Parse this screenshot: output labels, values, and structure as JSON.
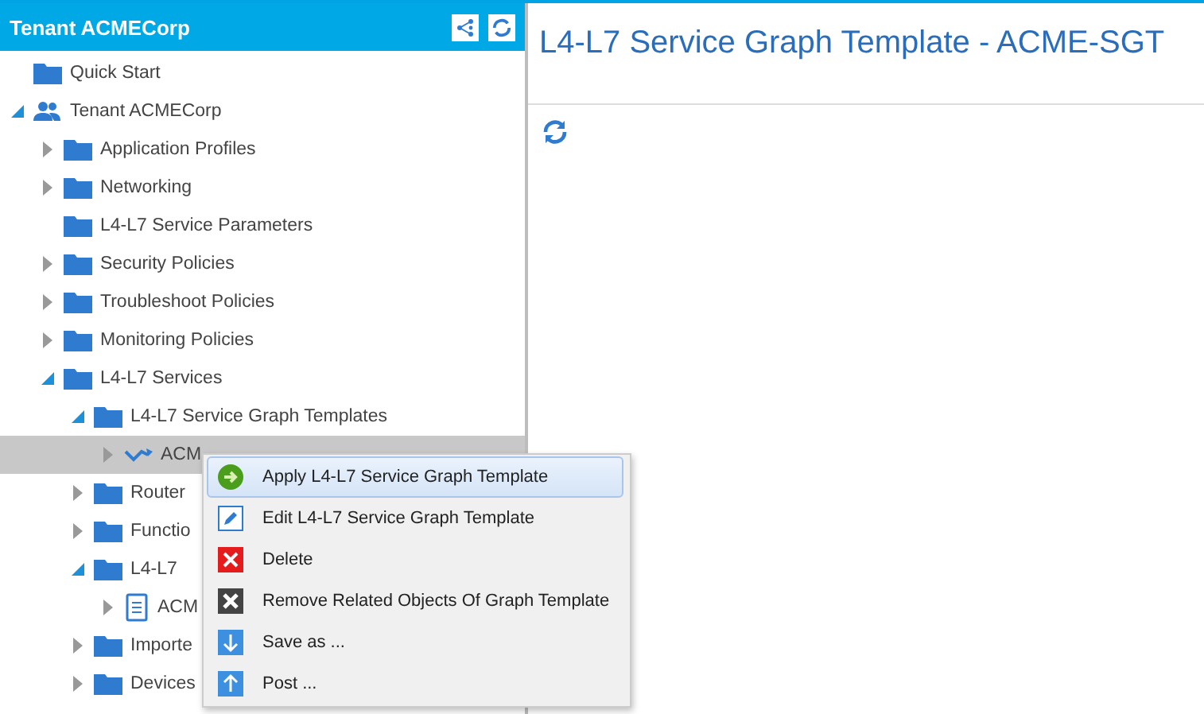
{
  "sidebar": {
    "title": "Tenant ACMECorp",
    "tree": [
      {
        "label": "Quick Start",
        "kind": "folder",
        "selected": false
      },
      {
        "label": "Tenant ACMECorp",
        "kind": "tenant",
        "selected": false,
        "expanded": true,
        "children": [
          {
            "label": "Application Profiles",
            "kind": "folder",
            "selected": false,
            "expanded": false
          },
          {
            "label": "Networking",
            "kind": "folder",
            "selected": false,
            "expanded": false
          },
          {
            "label": "L4-L7 Service Parameters",
            "kind": "folder",
            "selected": false
          },
          {
            "label": "Security Policies",
            "kind": "folder",
            "selected": false,
            "expanded": false
          },
          {
            "label": "Troubleshoot Policies",
            "kind": "folder",
            "selected": false,
            "expanded": false
          },
          {
            "label": "Monitoring Policies",
            "kind": "folder",
            "selected": false,
            "expanded": false
          },
          {
            "label": "L4-L7 Services",
            "kind": "folder",
            "selected": false,
            "expanded": true,
            "children": [
              {
                "label": "L4-L7 Service Graph Templates",
                "kind": "folder",
                "selected": false,
                "expanded": true,
                "children": [
                  {
                    "label": "ACM",
                    "kind": "graph",
                    "selected": true,
                    "expanded": false
                  }
                ]
              },
              {
                "label": "Router",
                "kind": "folder",
                "selected": false,
                "expanded": false
              },
              {
                "label": "Functio",
                "kind": "folder",
                "selected": false,
                "expanded": false
              },
              {
                "label": "L4-L7",
                "kind": "folder",
                "selected": false,
                "expanded": true,
                "children": [
                  {
                    "label": "ACM",
                    "kind": "document",
                    "selected": false,
                    "expanded": false
                  }
                ]
              },
              {
                "label": "Importe",
                "kind": "folder",
                "selected": false,
                "expanded": false
              },
              {
                "label": "Devices",
                "kind": "folder",
                "selected": false,
                "expanded": false
              }
            ]
          }
        ]
      }
    ]
  },
  "main": {
    "title": "L4-L7 Service Graph Template - ACME-SGT"
  },
  "context_menu": [
    {
      "label": "Apply L4-L7 Service Graph Template",
      "kind": "apply",
      "selected": true
    },
    {
      "label": "Edit L4-L7 Service Graph Template",
      "kind": "edit",
      "selected": false
    },
    {
      "label": "Delete",
      "kind": "delete",
      "selected": false
    },
    {
      "label": "Remove Related Objects Of Graph Template",
      "kind": "remove",
      "selected": false
    },
    {
      "label": "Save as ...",
      "kind": "save",
      "selected": false
    },
    {
      "label": "Post ...",
      "kind": "post",
      "selected": false
    }
  ]
}
